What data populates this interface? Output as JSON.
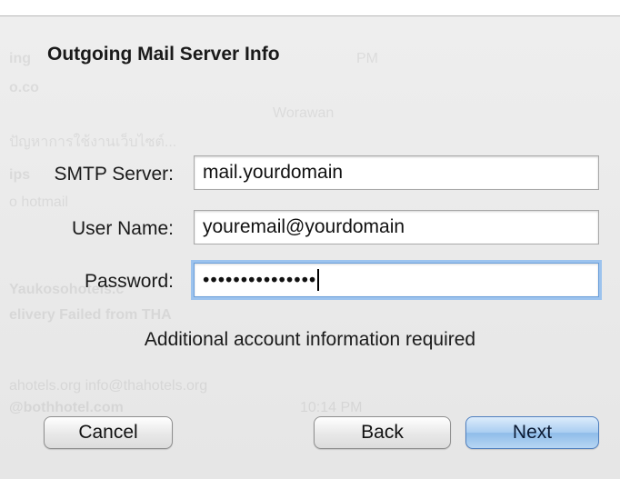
{
  "dialog": {
    "title": "Outgoing Mail Server Info",
    "info": "Additional account information required"
  },
  "fields": {
    "smtp_server": {
      "label": "SMTP Server:",
      "value": "mail.yourdomain"
    },
    "user_name": {
      "label": "User Name:",
      "value": "youremail@yourdomain"
    },
    "password": {
      "label": "Password:",
      "value": "•••••••••••••••"
    }
  },
  "buttons": {
    "cancel": "Cancel",
    "back": "Back",
    "next": "Next"
  },
  "colors": {
    "focus_ring": "#9cc3ee",
    "default_button": "#a9cdf1"
  }
}
